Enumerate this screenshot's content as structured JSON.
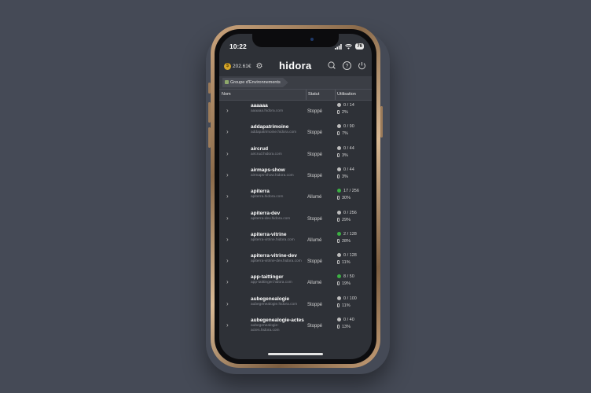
{
  "status_bar": {
    "time": "10:22",
    "battery": "76"
  },
  "header": {
    "balance": "202.61€",
    "logo": "hidora"
  },
  "breadcrumb": "Groupe d'Environnements",
  "table": {
    "headers": {
      "name": "Nom",
      "status": "Statut",
      "usage": "Utilisation"
    },
    "rows": [
      {
        "name": "aaaaaa",
        "host": "aaaaaa.hidora.com",
        "status": "Stoppé",
        "running": false,
        "cloudlets": "0 / 14",
        "disk": "2%"
      },
      {
        "name": "addapatrimoine",
        "host": "addapatrimoine.hidora.com",
        "status": "Stoppé",
        "running": false,
        "cloudlets": "0 / 90",
        "disk": "7%"
      },
      {
        "name": "aircrud",
        "host": "aircrud.hidora.com",
        "status": "Stoppé",
        "running": false,
        "cloudlets": "0 / 44",
        "disk": "3%"
      },
      {
        "name": "airmaps-show",
        "host": "airmaps-show.hidora.com",
        "status": "Stoppé",
        "running": false,
        "cloudlets": "0 / 44",
        "disk": "3%"
      },
      {
        "name": "apiterra",
        "host": "apiterra.hidora.com",
        "status": "Allumé",
        "running": true,
        "cloudlets": "17 / 256",
        "disk": "30%"
      },
      {
        "name": "apiterra-dev",
        "host": "apiterra-dev.hidora.com",
        "status": "Stoppé",
        "running": false,
        "cloudlets": "0 / 256",
        "disk": "29%"
      },
      {
        "name": "apiterra-vitrine",
        "host": "apiterra-vitrine.hidora.com",
        "status": "Allumé",
        "running": true,
        "cloudlets": "2 / 128",
        "disk": "28%"
      },
      {
        "name": "apiterra-vitrine-dev",
        "host": "apiterra-vitrine-dev.hidora.com",
        "status": "Stoppé",
        "running": false,
        "cloudlets": "0 / 128",
        "disk": "11%"
      },
      {
        "name": "app-taittinger",
        "host": "app-taittinger.hidora.com",
        "status": "Allumé",
        "running": true,
        "cloudlets": "8 / 50",
        "disk": "19%"
      },
      {
        "name": "aubegenealogie",
        "host": "aubegenealogie.hidora.com",
        "status": "Stoppé",
        "running": false,
        "cloudlets": "0 / 100",
        "disk": "11%"
      },
      {
        "name": "aubegenealogie-actes",
        "host": "aubegenealogie-actes.hidora.com",
        "status": "Stoppé",
        "running": false,
        "cloudlets": "0 / 40",
        "disk": "13%"
      }
    ]
  }
}
